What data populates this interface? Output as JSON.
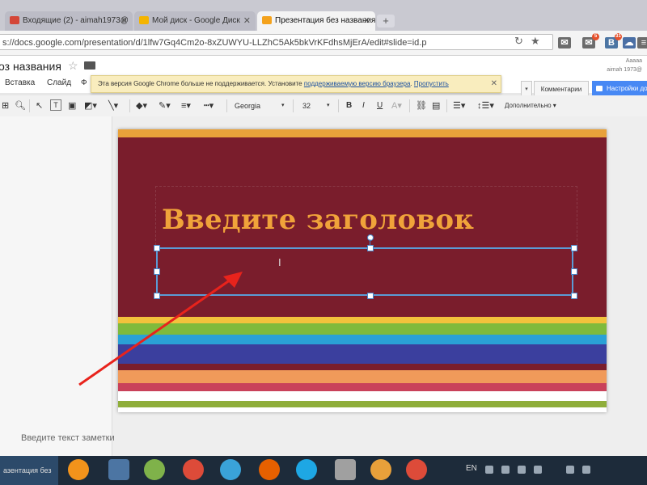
{
  "browser": {
    "tabs": [
      {
        "label": "Входящие (2) - aimah1973@",
        "icon_color": "#d44638",
        "active": false
      },
      {
        "label": "Мой диск - Google Диск",
        "icon_color": "#f4b400",
        "active": false
      },
      {
        "label": "Презентация без названия",
        "icon_color": "#f4a21c",
        "active": true
      }
    ],
    "url": "s://docs.google.com/presentation/d/1lfw7Gq4Cm2o-8xZUWYU-LLZhC5Ak5bkVrKFdhsMjErA/edit#slide=id.p",
    "extensions": [
      {
        "name": "mail-icon",
        "label": "✉",
        "color": "#6c6c6c"
      },
      {
        "name": "gmail-icon",
        "label": "✉",
        "color": "#6c6c6c",
        "badge": "5"
      },
      {
        "name": "vk-icon",
        "label": "В",
        "color": "#4c75a3",
        "badge": "31"
      },
      {
        "name": "cloud-icon",
        "label": "☁",
        "color": "#4a6fa5"
      },
      {
        "name": "menu-icon",
        "label": "≡",
        "color": "#6c6c6c"
      }
    ]
  },
  "docs": {
    "title": "оз названия",
    "account": "Aaaaa",
    "account_email": "aimah 1973@",
    "menu": [
      "Вставка",
      "Слайд",
      "Ф"
    ],
    "notice": {
      "text": "Эта версия Google Chrome больше не поддерживается. Установите ",
      "link": "поддерживаемую версию браузера",
      "dismiss": "Пропустить"
    },
    "comments_label": "Комментарии",
    "share_label": "Настройки до"
  },
  "toolbar": {
    "font": "Georgia",
    "size": "32",
    "bold": "B",
    "italic": "I",
    "underline": "U",
    "more": "Дополнительно"
  },
  "slide": {
    "title": "Введите заголовок",
    "notes_placeholder": "Введите текст заметки",
    "background": "#7a1d2c",
    "title_color": "#f0a33a",
    "stripes": [
      {
        "color": "#f2c23c"
      },
      {
        "color": "#7fba3c"
      },
      {
        "color": "#2aa1d6"
      },
      {
        "color": "#3b3f9e"
      },
      {
        "color": "#7a1d2c"
      },
      {
        "color": "#f09a5a"
      },
      {
        "color": "#c9415a"
      },
      {
        "color": "#ffffff"
      },
      {
        "color": "#8fae3a"
      }
    ]
  },
  "taskbar": {
    "active_label": "азентация без",
    "lang": "EN",
    "apps": [
      {
        "name": "odnoklassniki-icon",
        "color": "#f2931b"
      },
      {
        "name": "vk-icon",
        "color": "#4c75a3"
      },
      {
        "name": "chat-icon",
        "color": "#7fb24a"
      },
      {
        "name": "chrome-icon",
        "color": "#dd4b39"
      },
      {
        "name": "browser-icon",
        "color": "#3aa3d9"
      },
      {
        "name": "firefox-icon",
        "color": "#e66000"
      },
      {
        "name": "ie-icon",
        "color": "#1ea7e4"
      },
      {
        "name": "media-icon",
        "color": "#a0a0a0"
      },
      {
        "name": "photo-icon",
        "color": "#e8a03a"
      },
      {
        "name": "chrome-icon-2",
        "color": "#dd4b39"
      }
    ]
  }
}
